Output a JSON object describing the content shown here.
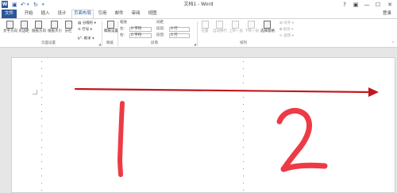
{
  "window": {
    "title": "文档1 - Word",
    "icon": "word-icon",
    "controls": [
      "?",
      "▣",
      "—",
      "☐",
      "✕"
    ]
  },
  "quick_access": [
    "save-icon",
    "undo-icon",
    "redo-icon",
    "customize-icon"
  ],
  "tabs": [
    "文件",
    "开始",
    "插入",
    "设计",
    "页面布局",
    "引用",
    "邮件",
    "审阅",
    "视图"
  ],
  "active_tab": "页面布局",
  "signin_label": "登录",
  "ribbon": {
    "page_setup": {
      "buttons": [
        "文字方向",
        "页边距",
        "纸张方向",
        "纸张大小",
        "分栏"
      ],
      "small": [
        "分隔符",
        "行号",
        "断字"
      ],
      "group_label": "页面设置"
    },
    "paragraph_spacing": {
      "button": "稿纸设置",
      "group_label": "稿纸"
    },
    "paragraph": {
      "indent_header": "缩进",
      "spacing_header": "间距",
      "left_label": "左:",
      "right_label": "右:",
      "before_label": "段前:",
      "after_label": "段后:",
      "left_value": "0 字符",
      "right_value": "0 字符",
      "before_value": "0 行",
      "after_value": "0 行",
      "group_label": "段落"
    },
    "arrange": {
      "buttons": [
        "位置",
        "自动换行",
        "上移一层",
        "下移一层",
        "选择窗格"
      ],
      "small": [
        "对齐",
        "组合",
        "旋转"
      ],
      "group_label": "排列"
    }
  },
  "drawing": {
    "arrow_color": "#c0181f",
    "number_color": "#ee3a45",
    "numbers": [
      "1",
      "2"
    ]
  }
}
